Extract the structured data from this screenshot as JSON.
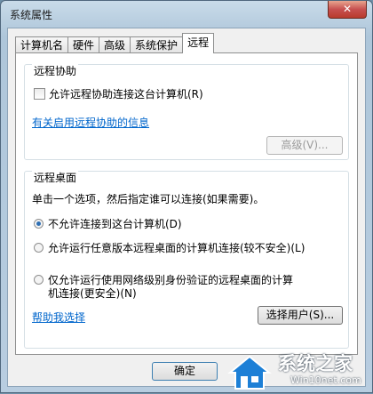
{
  "window": {
    "title": "系统属性",
    "close_label": "✕"
  },
  "tabs": [
    "计算机名",
    "硬件",
    "高级",
    "系统保护",
    "远程"
  ],
  "remote_assistance": {
    "group_title": "远程协助",
    "allow_label": "允许远程协助连接这台计算机(R)",
    "allow_checked": false,
    "info_link": "有关启用远程协助的信息",
    "advanced_button": "高级(V)..."
  },
  "remote_desktop": {
    "group_title": "远程桌面",
    "instruction": "单击一个选项，然后指定谁可以连接(如果需要)。",
    "options": [
      "不允许连接到这台计算机(D)",
      "允许运行任意版本远程桌面的计算机连接(较不安全)(L)",
      "仅允许运行使用网络级别身份验证的远程桌面的计算机连接(更安全)(N)"
    ],
    "option3_line1": "仅允许运行使用网络级别身份验证的远程桌面的计算",
    "option3_line2": "机连接(更安全)(N)",
    "selected_index": 0,
    "help_link": "帮助我选择",
    "select_users_button": "选择用户(S)..."
  },
  "footer": {
    "ok_button": "确定"
  },
  "watermark": {
    "brand": "系统之家",
    "url": "Win10net.com"
  }
}
